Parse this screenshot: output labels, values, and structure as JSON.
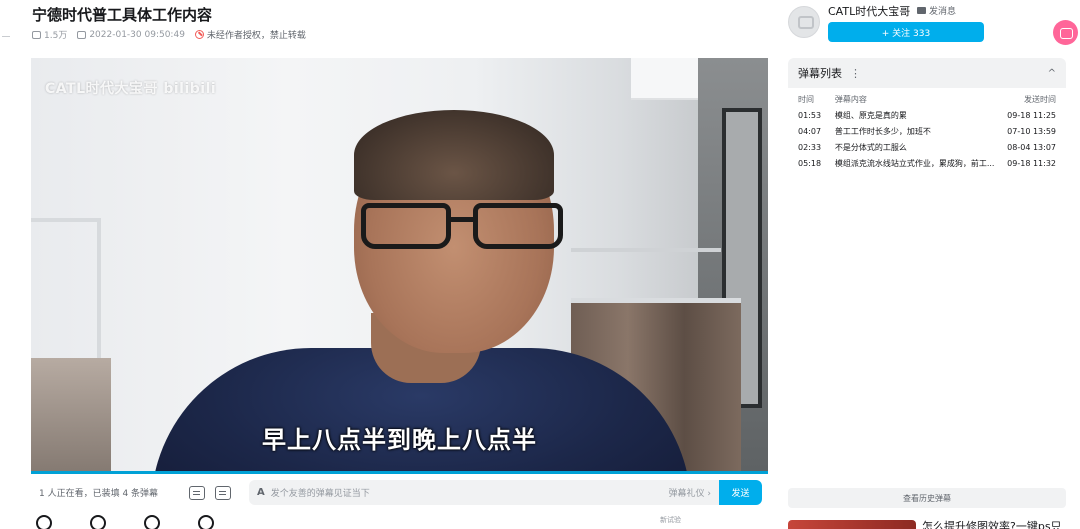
{
  "video": {
    "title": "宁德时代普工具体工作内容",
    "views": "1.5万",
    "date": "2022-01-30 09:50:49",
    "no_repost": "未经作者授权，禁止转载",
    "watermark": "CATL时代大宝哥 bilibili",
    "subtitle": "早上八点半到晚上八点半"
  },
  "danmaku_bar": {
    "viewers": "1 人正在看，已装填 4 条弹幕",
    "placeholder": "发个友善的弹幕见证当下",
    "etiquette": "弹幕礼仪 ›",
    "send_label": "发送"
  },
  "uploader": {
    "name": "CATL时代大宝哥",
    "message_label": "发消息",
    "follow_label": "+ 关注 333"
  },
  "danmaku_list": {
    "title": "弹幕列表",
    "more": "⋮",
    "collapse": "^",
    "columns": [
      "时间",
      "弹幕内容",
      "发送时间"
    ],
    "rows": [
      {
        "time": "01:53",
        "text": "模组、原克是真的累",
        "sent": "09-18 11:25"
      },
      {
        "time": "04:07",
        "text": "普工工作时长多少，加班不",
        "sent": "07-10 13:59"
      },
      {
        "time": "02:33",
        "text": "不是分体式的工服么",
        "sent": "08-04 13:07"
      },
      {
        "time": "05:18",
        "text": "模组派克流水线站立式作业，累成狗，前工...",
        "sent": "09-18 11:32"
      }
    ],
    "history_label": "查看历史弹幕"
  },
  "recommend": {
    "title": "怎么提升修图效率?一键ps只"
  },
  "misc": {
    "trial_tag": "新试验"
  },
  "colors": {
    "accent": "#00aeec",
    "progress": "#00a1d6",
    "pink": "#ff6699"
  }
}
